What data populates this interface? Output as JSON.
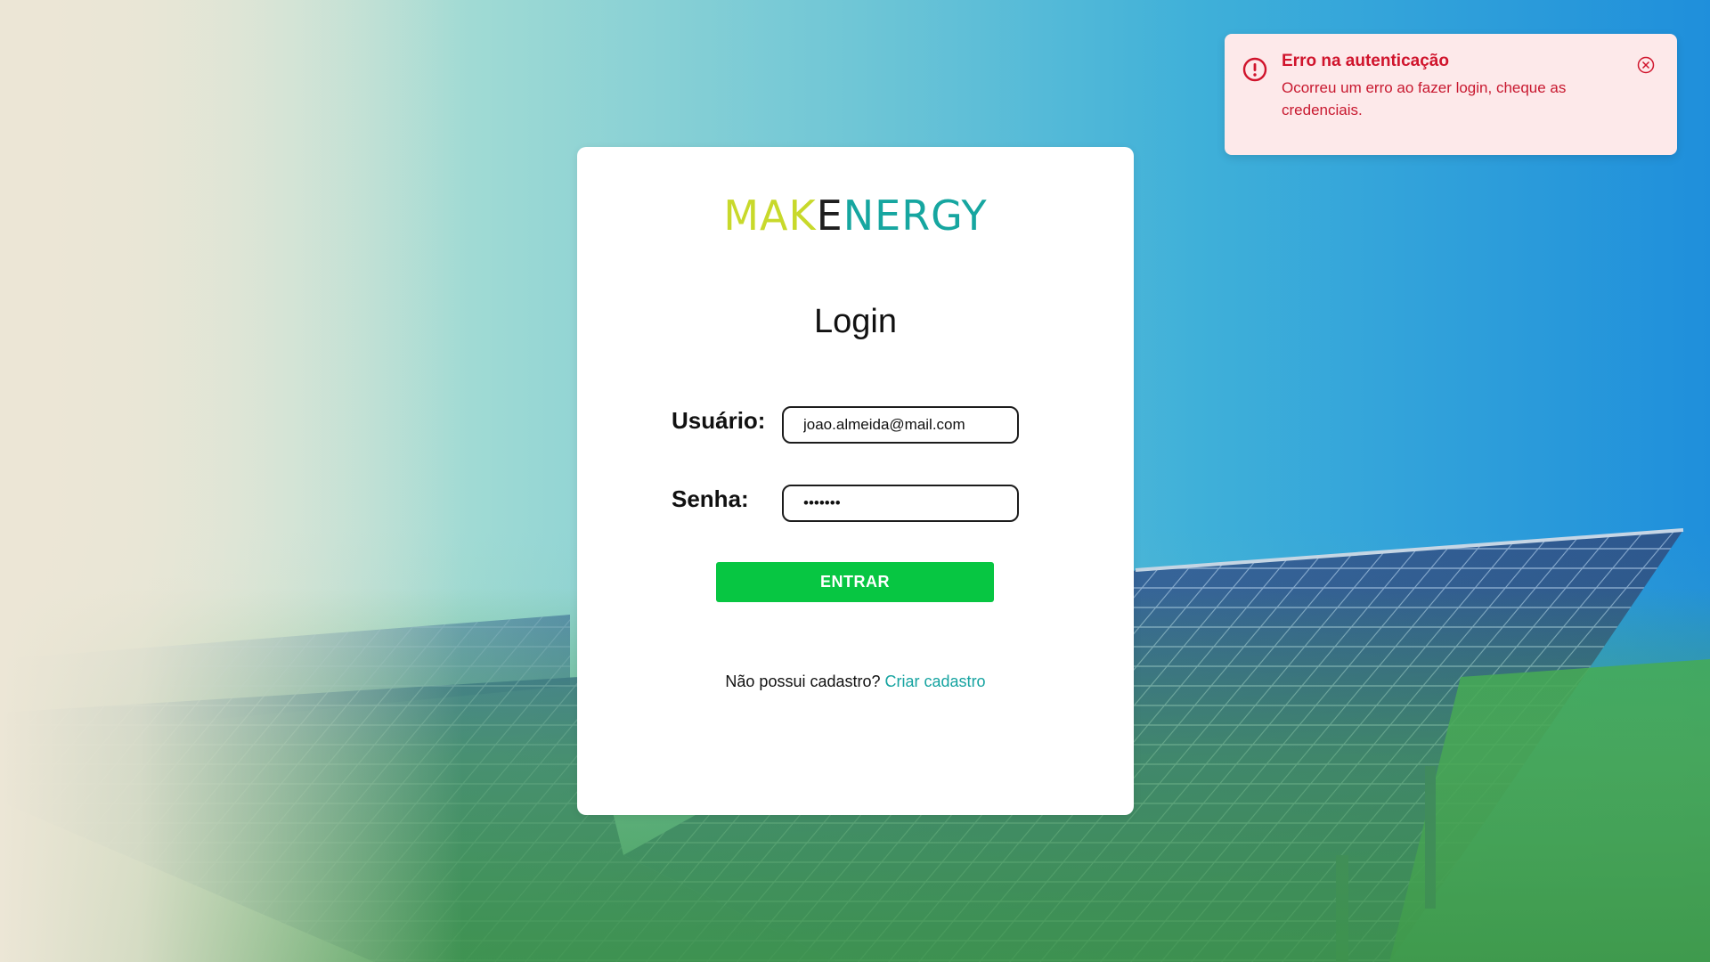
{
  "brand": {
    "logo_part1": "MAK",
    "logo_part2": "E",
    "logo_part3": "NERGY"
  },
  "login": {
    "title": "Login",
    "user_label": "Usuário:",
    "user_value": "joao.almeida@mail.com",
    "password_label": "Senha:",
    "password_value": "•••••••",
    "submit_label": "ENTRAR",
    "signup_prompt": "Não possui cadastro?",
    "signup_link": "Criar cadastro"
  },
  "toast": {
    "title": "Erro na autenticação",
    "message": "Ocorreu um erro ao fazer login, cheque as credenciais.",
    "icon": "error-circle-icon",
    "close_icon": "close-circle-icon",
    "color": "#d0142c",
    "background": "#fde9ea"
  },
  "colors": {
    "accent_green": "#07c642",
    "link_teal": "#15a3a0",
    "logo_yellow": "#c8d92b"
  }
}
